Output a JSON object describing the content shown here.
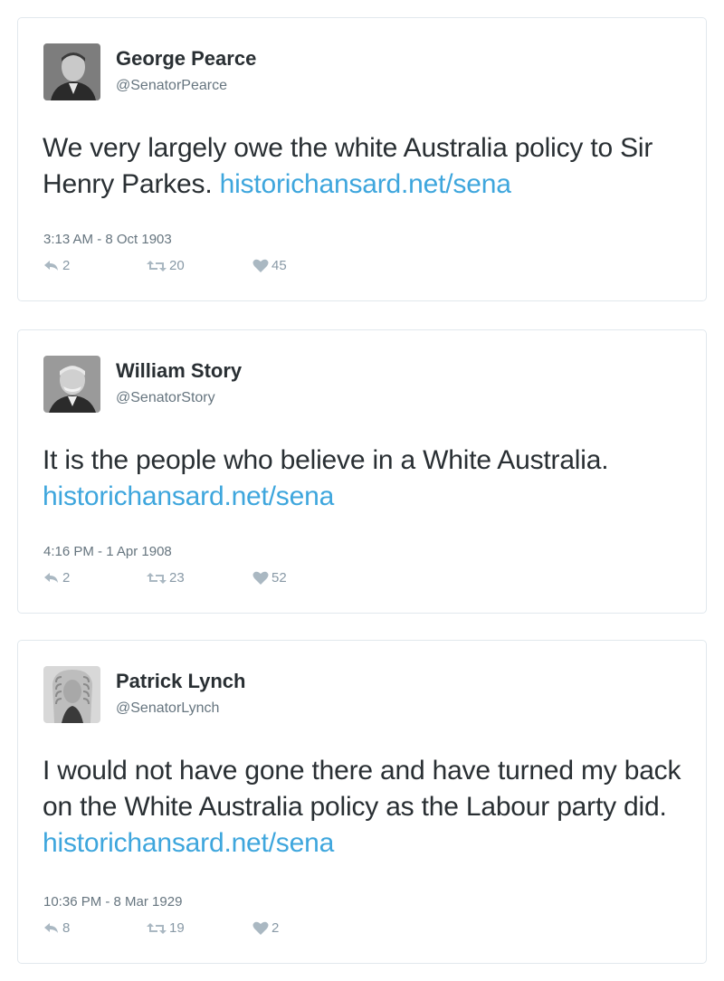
{
  "tweets": [
    {
      "name": "George Pearce",
      "handle": "@SenatorPearce",
      "text": "We very largely owe the white Australia policy to Sir Henry Parkes. ",
      "link": "historichansard.net/sena",
      "timestamp": "3:13 AM - 8 Oct 1903",
      "replies": "2",
      "retweets": "20",
      "likes": "45"
    },
    {
      "name": "William Story",
      "handle": "@SenatorStory",
      "text": "It is the people who believe in a White Australia. ",
      "link": "historichansard.net/sena",
      "timestamp": "4:16 PM - 1 Apr 1908",
      "replies": "2",
      "retweets": "23",
      "likes": "52"
    },
    {
      "name": "Patrick Lynch",
      "handle": "@SenatorLynch",
      "text": "I would not have gone there and have turned my back on the White Australia policy as the Labour party did. ",
      "link": "historichansard.net/sena",
      "timestamp": "10:36 PM - 8 Mar 1929",
      "replies": "8",
      "retweets": "19",
      "likes": "2"
    }
  ],
  "icons": {
    "reply": "reply-icon",
    "retweet": "retweet-icon",
    "like": "heart-icon"
  },
  "colors": {
    "link": "#3ea6dd",
    "name": "#292f33",
    "muted": "#66757f",
    "action": "#8899a6",
    "border": "#e1e8ed"
  }
}
